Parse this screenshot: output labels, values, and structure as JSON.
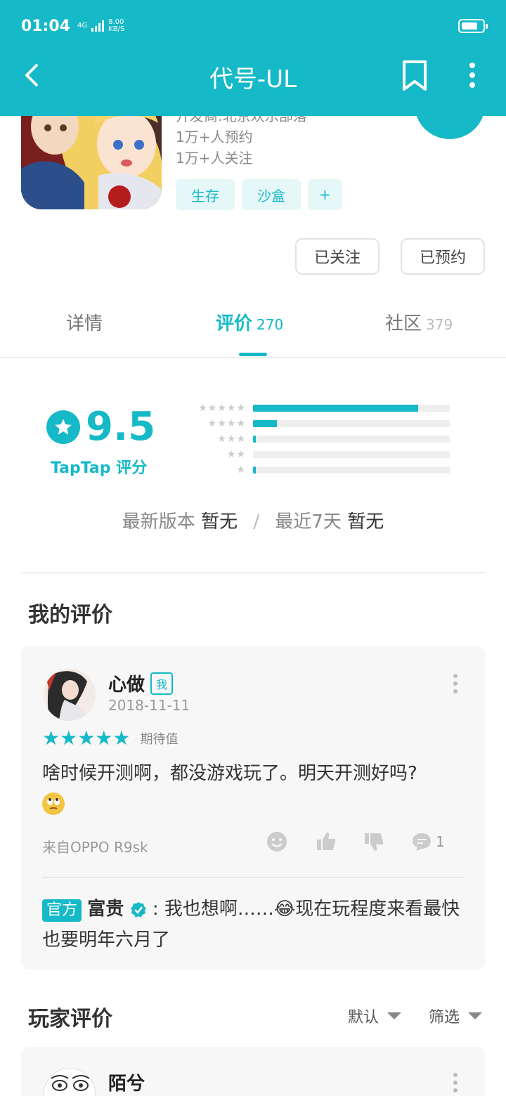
{
  "status": {
    "time": "01:04",
    "network": "4G",
    "speed_value": "8.00",
    "speed_unit": "KB/S"
  },
  "header": {
    "title": "代号-UL"
  },
  "app": {
    "developer": "开发商:北京欢乐部落",
    "reservations": "1万+人预约",
    "followers": "1万+人关注",
    "tags": [
      "生存",
      "沙盒"
    ],
    "tag_add": "+"
  },
  "buttons": {
    "followed": "已关注",
    "reserved": "已预约"
  },
  "tabs": [
    {
      "label": "详情",
      "count": ""
    },
    {
      "label": "评价",
      "count": "270"
    },
    {
      "label": "社区",
      "count": "379"
    }
  ],
  "rating": {
    "score": "9.5",
    "label": "TapTap 评分",
    "distribution": [
      {
        "stars": 5,
        "percent": 84
      },
      {
        "stars": 4,
        "percent": 12
      },
      {
        "stars": 3,
        "percent": 1.5
      },
      {
        "stars": 2,
        "percent": 0
      },
      {
        "stars": 1,
        "percent": 1.5
      }
    ],
    "latest_label": "最新版本",
    "latest_value": "暂无",
    "separator": "/",
    "recent_label": "最近7天",
    "recent_value": "暂无"
  },
  "my_review": {
    "section_title": "我的评价",
    "user": "心做",
    "badge": "我",
    "date": "2018-11-11",
    "stars": 5,
    "star_glyphs": "★★★★★",
    "rating_type": "期待值",
    "text": "啥时候开测啊，都没游戏玩了。明天开测好吗?",
    "device": "来自OPPO R9sk",
    "reply_count": "1",
    "reply": {
      "badge": "官方",
      "author": "富贵",
      "text": ": 我也想啊……😂现在玩程度来看最快也要明年六月了"
    }
  },
  "player_reviews": {
    "section_title": "玩家评价",
    "sort_default": "默认",
    "sort_filter": "筛选",
    "first_user": "陌兮"
  },
  "colors": {
    "accent": "#15b9c7"
  }
}
